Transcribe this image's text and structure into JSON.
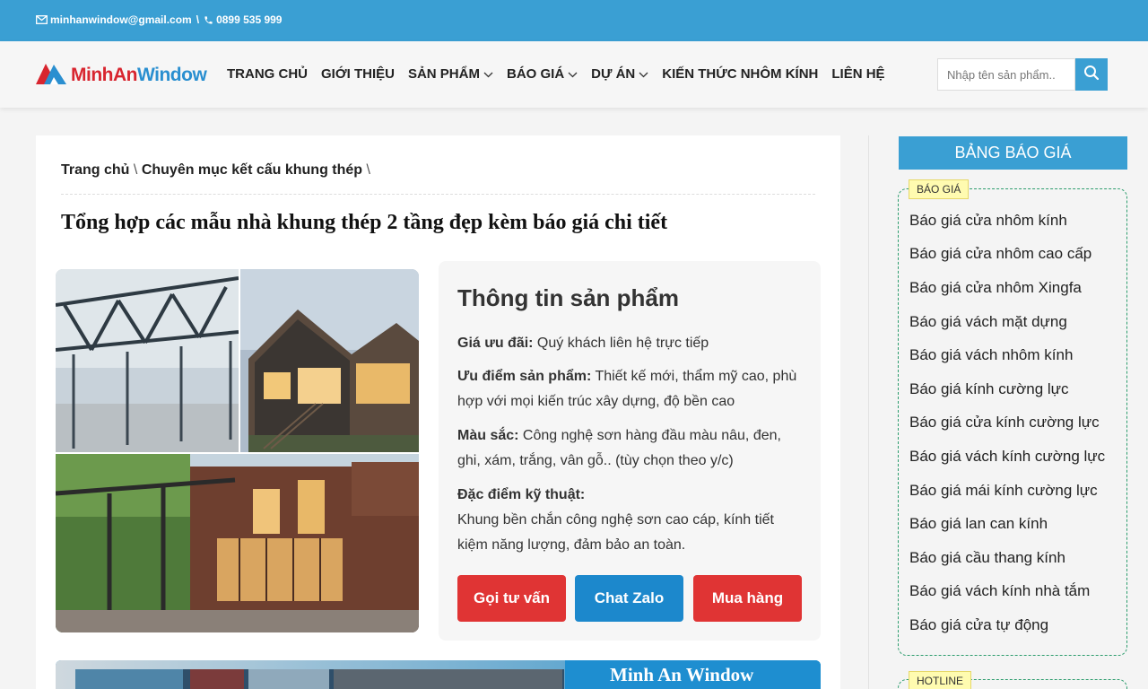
{
  "topbar": {
    "email": "minhanwindow@gmail.com",
    "separator": "\\",
    "phone": "0899 535 999"
  },
  "logo": {
    "part1": "MinhAn",
    "part2": "Window"
  },
  "nav": [
    {
      "label": "TRANG CHỦ",
      "dropdown": false
    },
    {
      "label": "GIỚI THIỆU",
      "dropdown": false
    },
    {
      "label": "SẢN PHẨM",
      "dropdown": true
    },
    {
      "label": "BÁO GIÁ",
      "dropdown": true
    },
    {
      "label": "DỰ ÁN",
      "dropdown": true
    },
    {
      "label": "KIẾN THỨC NHÔM KÍNH",
      "dropdown": false
    },
    {
      "label": "LIÊN HỆ",
      "dropdown": false
    }
  ],
  "search": {
    "placeholder": "Nhập tên sản phẩm..",
    "value": ""
  },
  "breadcrumb": {
    "home": "Trang chủ",
    "category": "Chuyên mục kết cấu khung thép",
    "sep": "\\"
  },
  "article": {
    "title": "Tổng hợp các mẫu nhà khung thép 2 tầng đẹp kèm báo giá chi tiết"
  },
  "info": {
    "title": "Thông tin sản phẩm",
    "price_label": "Giá ưu đãi:",
    "price_value": " Quý khách liên hệ trực tiếp",
    "adv_label": "Ưu điểm sản phẩm:",
    "adv_value": " Thiết kế mới, thẩm mỹ cao, phù hợp với mọi kiến trúc xây dựng, độ bền cao",
    "color_label": "Màu sắc:",
    "color_value": " Công nghệ sơn hàng đầu màu nâu, đen, ghi, xám, trắng, vân gỗ.. (tùy chọn theo y/c)",
    "tech_label": "Đặc điểm kỹ thuật:",
    "tech_value": "Khung bền chắn công nghệ sơn cao cáp, kính tiết kiệm năng lượng, đảm bảo an toàn.",
    "buttons": {
      "call": "Gọi tư vấn",
      "zalo": "Chat Zalo",
      "buy": "Mua hàng"
    }
  },
  "banner": {
    "title": "Minh An Window"
  },
  "sidebar": {
    "heading": "BẢNG BÁO GIÁ",
    "tag": "BÁO GIÁ",
    "links": [
      "Báo giá cửa nhôm kính",
      "Báo giá cửa nhôm cao cấp",
      "Báo giá cửa nhôm Xingfa",
      "Báo giá vách mặt dựng",
      "Báo giá vách nhôm kính",
      "Báo giá kính cường lực",
      "Báo giá cửa kính cường lực",
      "Báo giá vách kính cường lực",
      "Báo giá mái kính cường lực",
      "Báo giá lan can kính",
      "Báo giá cầu thang kính",
      "Báo giá vách kính nhà tắm",
      "Báo giá cửa tự động"
    ],
    "tag2": "HOTLINE"
  },
  "colors": {
    "brand_blue": "#3a9fd3",
    "logo_red": "#d8252f",
    "button_red": "#e03434",
    "button_blue": "#1c88cc"
  }
}
